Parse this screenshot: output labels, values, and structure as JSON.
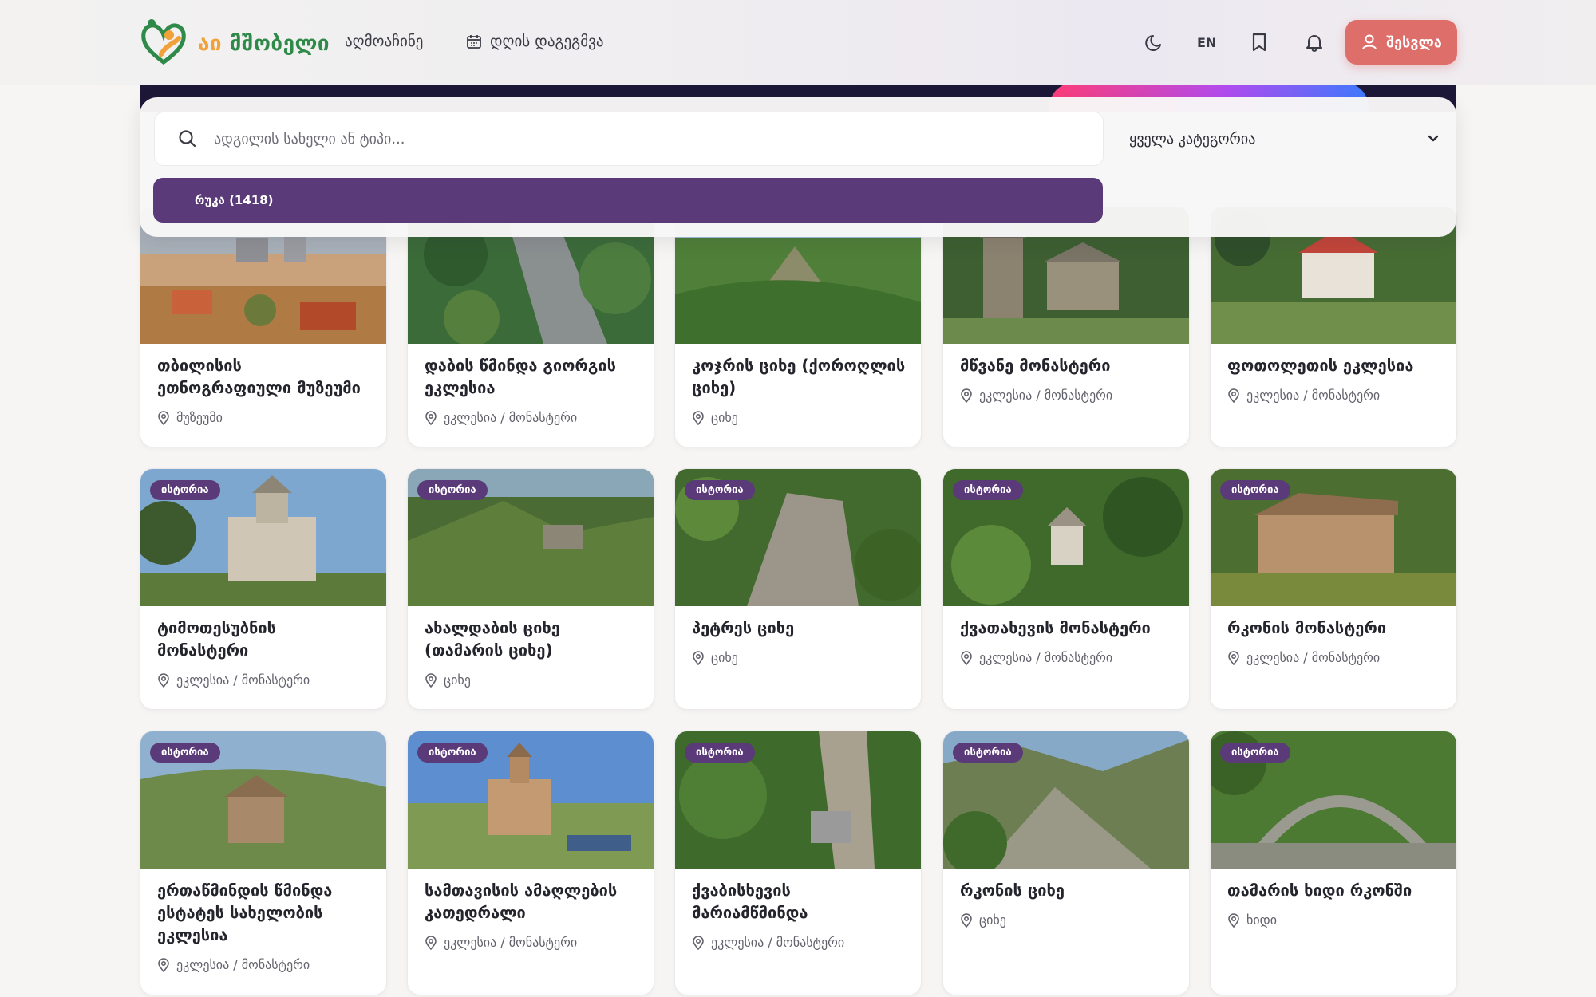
{
  "header": {
    "logo_text_a": "აი",
    "logo_text_b": "მშობელი",
    "nav": [
      {
        "label": "აღმოაჩინე"
      },
      {
        "label": "დღის დაგეგმვა"
      }
    ],
    "lang": "EN",
    "login_label": "შესვლა",
    "icons": [
      "moon-icon",
      "bookmark-icon",
      "bell-icon",
      "user-icon"
    ]
  },
  "search": {
    "placeholder": "ადგილის სახელი ან ტიპი...",
    "category_selected": "ყველა კატეგორია",
    "map_button": "რუკა (1418)"
  },
  "cards": [
    {
      "title": "თბილისის ეთნოგრაფიული მუზეუმი",
      "category": "მუზეუმი",
      "badge": ""
    },
    {
      "title": "დაბის წმინდა გიორგის ეკლესია",
      "category": "ეკლესია / მონასტერი",
      "badge": ""
    },
    {
      "title": "კოჯრის ციხე (ქოროღლის ციხე)",
      "category": "ციხე",
      "badge": ""
    },
    {
      "title": "მწვანე მონასტერი",
      "category": "ეკლესია / მონასტერი",
      "badge": ""
    },
    {
      "title": "ფოთოლეთის ეკლესია",
      "category": "ეკლესია / მონასტერი",
      "badge": ""
    },
    {
      "title": "ტიმოთესუბნის მონასტერი",
      "category": "ეკლესია / მონასტერი",
      "badge": "ისტორია"
    },
    {
      "title": "ახალდაბის ციხე (თამარის ციხე)",
      "category": "ციხე",
      "badge": "ისტორია"
    },
    {
      "title": "პეტრეს ციხე",
      "category": "ციხე",
      "badge": "ისტორია"
    },
    {
      "title": "ქვათახევის მონასტერი",
      "category": "ეკლესია / მონასტერი",
      "badge": "ისტორია"
    },
    {
      "title": "რკონის მონასტერი",
      "category": "ეკლესია / მონასტერი",
      "badge": "ისტორია"
    },
    {
      "title": "ერთაწმინდის წმინდა ესტატეს სახელობის ეკლესია",
      "category": "ეკლესია / მონასტერი",
      "badge": "ისტორია"
    },
    {
      "title": "სამთავისის ამაღლების კათედრალი",
      "category": "ეკლესია / მონასტერი",
      "badge": "ისტორია"
    },
    {
      "title": "ქვაბისხევის მარიამწმინდა",
      "category": "ეკლესია / მონასტერი",
      "badge": "ისტორია"
    },
    {
      "title": "რკონის ციხე",
      "category": "ციხე",
      "badge": "ისტორია"
    },
    {
      "title": "თამარის ხიდი რკონში",
      "category": "ხიდი",
      "badge": "ისტორია"
    }
  ]
}
